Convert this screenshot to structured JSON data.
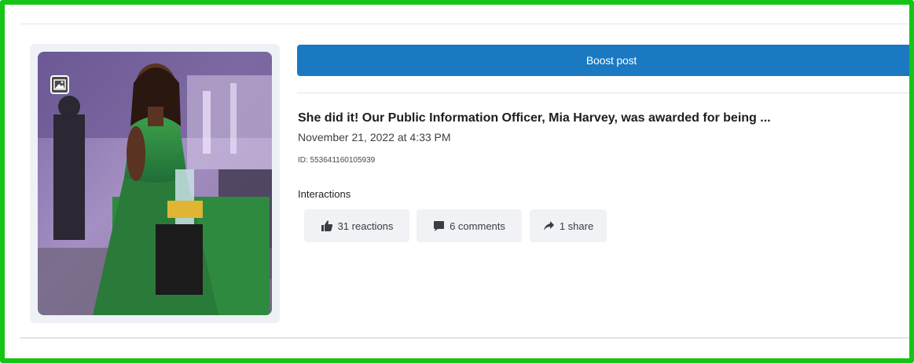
{
  "colors": {
    "frame_border": "#16c416",
    "boost_button_bg": "#1a79c1",
    "chip_bg": "#f0f2f5",
    "text_primary": "#1c1e21"
  },
  "post": {
    "boost_label": "Boost post",
    "title": "She did it! Our Public Information Officer, Mia Harvey, was awarded for being ...",
    "date": "November 21, 2022 at 4:33 PM",
    "id_text": "ID: 553641160105939",
    "thumbnail_icon": "image-icon"
  },
  "interactions": {
    "label": "Interactions",
    "reactions": {
      "icon": "thumbs-up-icon",
      "label": "31 reactions"
    },
    "comments": {
      "icon": "comment-icon",
      "label": "6 comments"
    },
    "shares": {
      "icon": "share-arrow-icon",
      "label": "1 share"
    }
  }
}
